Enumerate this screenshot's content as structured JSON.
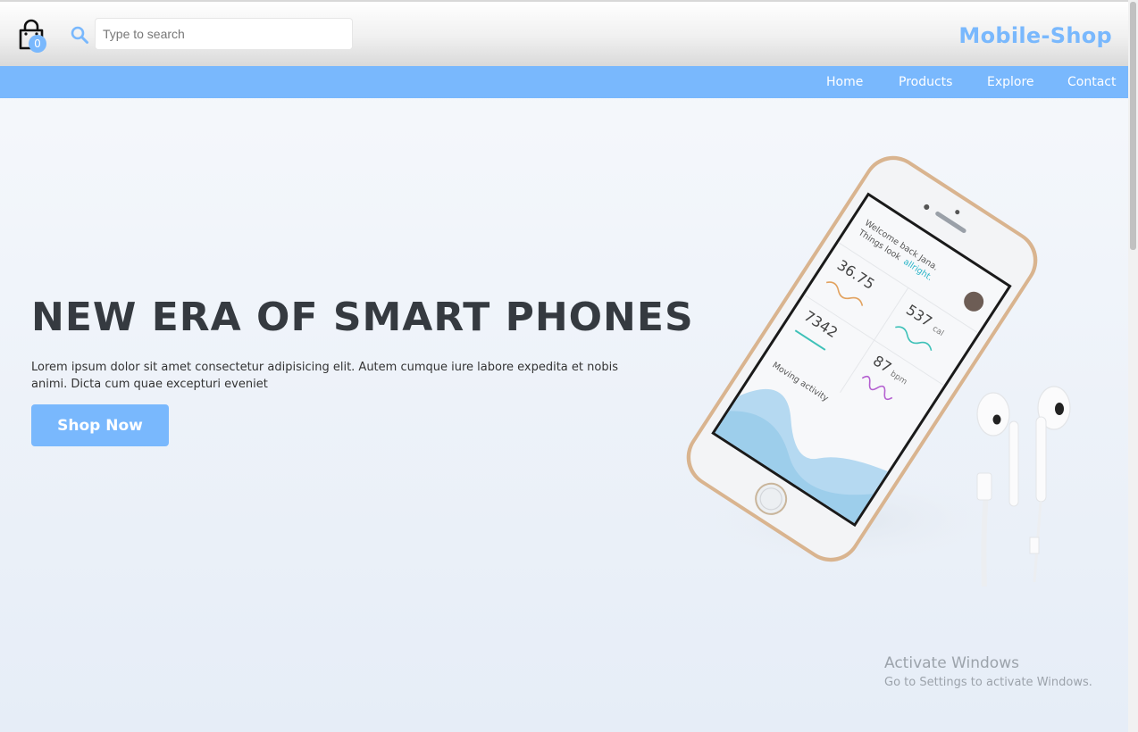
{
  "header": {
    "cart_count": "0",
    "search_placeholder": "Type to search",
    "brand": "Mobile-Shop",
    "cart_icon": "shopping-bag-icon",
    "search_icon": "magnifier-icon"
  },
  "nav": {
    "items": [
      "Home",
      "Products",
      "Explore",
      "Contact"
    ]
  },
  "hero": {
    "title": "NEW ERA OF SMART PHONES",
    "text": "Lorem ipsum dolor sit amet consectetur adipisicing elit. Autem cumque iure labore expedita et nobis animi. Dicta cum quae excepturi eveniet",
    "button_label": "Shop Now"
  },
  "phone_screen": {
    "greeting": "Welcome back Jana.",
    "greeting2": "Things look",
    "greeting_highlight": "allright.",
    "stat1": "36.75",
    "stat2": "7342",
    "stat3": "537",
    "stat3_unit": "cal",
    "stat4": "87",
    "stat4_unit": "bpm",
    "activity": "Moving activity"
  },
  "watermark": {
    "line1": "Activate Windows",
    "line2": "Go to Settings to activate Windows."
  },
  "colors": {
    "accent": "#79b8fd",
    "title": "#353a40"
  }
}
